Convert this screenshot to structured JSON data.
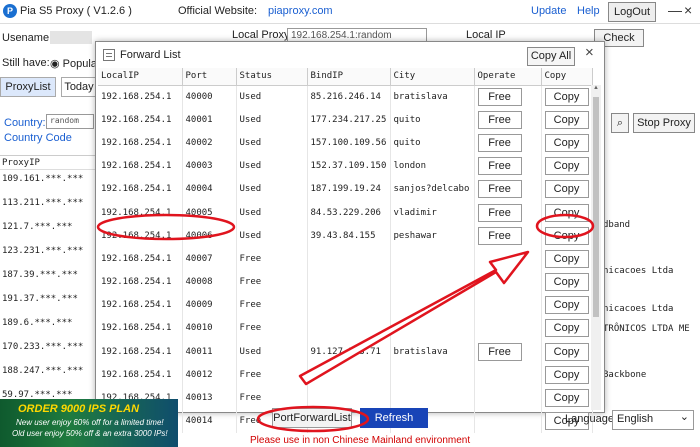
{
  "titlebar": {
    "app_title": "Pia S5 Proxy  ( V1.2.6 )",
    "website_label": "Official Website:",
    "website_link": "piaproxy.com",
    "update": "Update",
    "help": "Help",
    "logout": "LogOut",
    "minimize": "—",
    "close": "×"
  },
  "background": {
    "username_label": "Usename:",
    "local_proxy_label": "Local Proxy",
    "local_proxy_value": "192.168.254.1:random",
    "local_ip_label": "Local IP",
    "check_button": "Check",
    "still_have_label": "Still have:",
    "popular_label": "Popular",
    "proxylist_tab": "ProxyList",
    "today_tab": "Today",
    "country_label": "Country:",
    "country_value": "random",
    "country_code": "Country Code",
    "stop_proxy": "Stop Proxy",
    "list_header": "ProxyIP",
    "left_rows": [
      "109.161.***.***",
      "113.211.***.***",
      "121.7.***.***",
      "123.231.***.***",
      "187.39.***.***",
      "191.37.***.***",
      "189.6.***.***",
      "170.233.***.***",
      "188.247.***.***",
      "59.97.***.***"
    ],
    "right_texts": [
      "dband",
      "nicacoes Ltda",
      "nicacoes Ltda",
      "TRÔNICOS LTDA ME",
      "Backbone"
    ]
  },
  "dialog": {
    "title": "Forward List",
    "copy_all": "Copy All",
    "close": "×",
    "columns": [
      "LocalIP",
      "Port",
      "Status",
      "BindIP",
      "City",
      "Operate",
      "Copy"
    ],
    "rows": [
      {
        "ip": "192.168.254.1",
        "port": "40000",
        "status": "Used",
        "bind": "85.216.246.14",
        "city": "bratislava",
        "operate": "Free",
        "copy": "Copy"
      },
      {
        "ip": "192.168.254.1",
        "port": "40001",
        "status": "Used",
        "bind": "177.234.217.25",
        "city": "quito",
        "operate": "Free",
        "copy": "Copy"
      },
      {
        "ip": "192.168.254.1",
        "port": "40002",
        "status": "Used",
        "bind": "157.100.109.56",
        "city": "quito",
        "operate": "Free",
        "copy": "Copy"
      },
      {
        "ip": "192.168.254.1",
        "port": "40003",
        "status": "Used",
        "bind": "152.37.109.150",
        "city": "london",
        "operate": "Free",
        "copy": "Copy"
      },
      {
        "ip": "192.168.254.1",
        "port": "40004",
        "status": "Used",
        "bind": "187.199.19.24",
        "city": "sanjos?delcabo",
        "operate": "Free",
        "copy": "Copy"
      },
      {
        "ip": "192.168.254.1",
        "port": "40005",
        "status": "Used",
        "bind": "84.53.229.206",
        "city": "vladimir",
        "operate": "Free",
        "copy": "Copy"
      },
      {
        "ip": "192.168.254.1",
        "port": "40006",
        "status": "Used",
        "bind": "39.43.84.155",
        "city": "peshawar",
        "operate": "Free",
        "copy": "Copy"
      },
      {
        "ip": "192.168.254.1",
        "port": "40007",
        "status": "Free",
        "bind": "",
        "city": "",
        "operate": "",
        "copy": "Copy"
      },
      {
        "ip": "192.168.254.1",
        "port": "40008",
        "status": "Free",
        "bind": "",
        "city": "",
        "operate": "",
        "copy": "Copy"
      },
      {
        "ip": "192.168.254.1",
        "port": "40009",
        "status": "Free",
        "bind": "",
        "city": "",
        "operate": "",
        "copy": "Copy"
      },
      {
        "ip": "192.168.254.1",
        "port": "40010",
        "status": "Free",
        "bind": "",
        "city": "",
        "operate": "",
        "copy": "Copy"
      },
      {
        "ip": "192.168.254.1",
        "port": "40011",
        "status": "Used",
        "bind": "91.127.203.71",
        "city": "bratislava",
        "operate": "Free",
        "copy": "Copy"
      },
      {
        "ip": "192.168.254.1",
        "port": "40012",
        "status": "Free",
        "bind": "",
        "city": "",
        "operate": "",
        "copy": "Copy"
      },
      {
        "ip": "192.168.254.1",
        "port": "40013",
        "status": "Free",
        "bind": "",
        "city": "",
        "operate": "",
        "copy": "Copy"
      },
      {
        "ip": "192.168.254.1",
        "port": "40014",
        "status": "Free",
        "bind": "",
        "city": "",
        "operate": "",
        "copy": "Copy"
      }
    ]
  },
  "bottom": {
    "banner_title": "ORDER 9000 IPS PLAN",
    "banner_line1": "New user enjoy 60% off for a limited time!",
    "banner_line2": "Old user enjoy 50% off & an extra 3000 IPs!",
    "port_forward_list": "PortForwardList",
    "refresh": "Refresh",
    "warning": "Please use in non Chinese Mainland environment",
    "language_label": "Language",
    "language_value": "English"
  },
  "colors": {
    "annotation_red": "#e0141e",
    "refresh_blue": "#1844b7",
    "link_blue": "#1a5fd1"
  }
}
